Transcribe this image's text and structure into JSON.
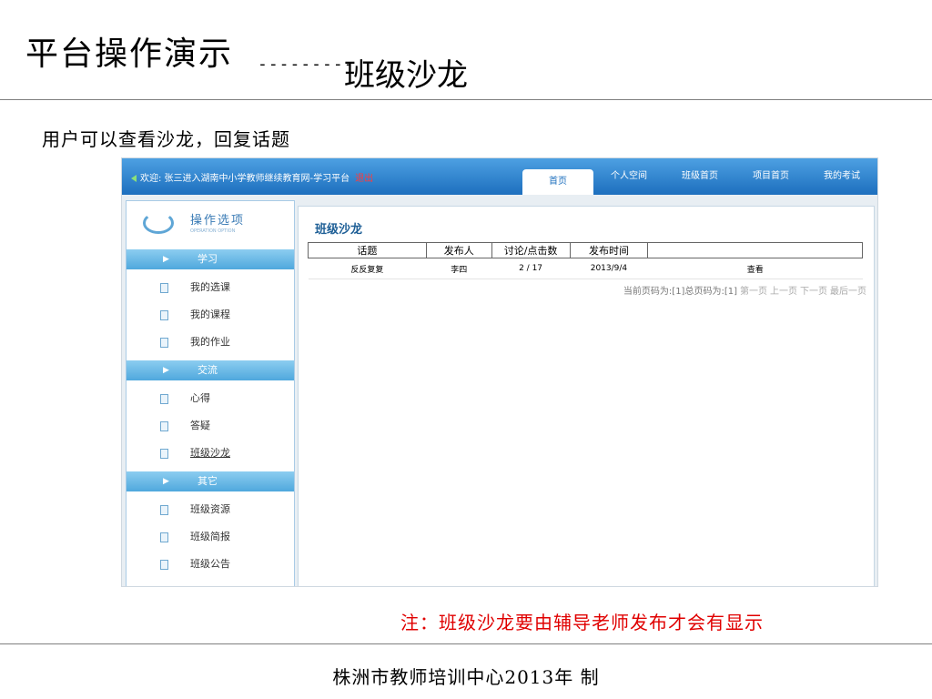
{
  "slide": {
    "title": "平台操作演示",
    "dash": "---------",
    "subtitle": "班级沙龙",
    "description": "用户可以查看沙龙，回复话题",
    "note": "注：班级沙龙要由辅导老师发布才会有显示",
    "footer": "株洲市教师培训中心2013年  制"
  },
  "portal": {
    "welcome": "欢迎: 张三进入湖南中小学教师继续教育网-学习平台",
    "exit": "退出",
    "nav": [
      "首页",
      "个人空间",
      "班级首页",
      "项目首页",
      "我的考试"
    ],
    "sidebar": {
      "title": "操作选项",
      "subtitle": "OPERATION OPTION",
      "sections": [
        {
          "label": "学习",
          "items": [
            "我的选课",
            "我的课程",
            "我的作业"
          ]
        },
        {
          "label": "交流",
          "items": [
            "心得",
            "答疑",
            "班级沙龙"
          ]
        },
        {
          "label": "其它",
          "items": [
            "班级资源",
            "班级简报",
            "班级公告"
          ]
        }
      ]
    },
    "panel_title": "班级沙龙",
    "table": {
      "headers": [
        "话题",
        "发布人",
        "讨论/点击数",
        "发布时间",
        ""
      ],
      "rows": [
        {
          "topic": "反反复复",
          "author": "李四",
          "stats": "2 / 17",
          "date": "2013/9/4",
          "action": "查看"
        }
      ]
    },
    "pager": {
      "text": "当前页码为:[1]总页码为:[1]",
      "first": "第一页",
      "prev": "上一页",
      "next": "下一页",
      "last": "最后一页"
    }
  }
}
